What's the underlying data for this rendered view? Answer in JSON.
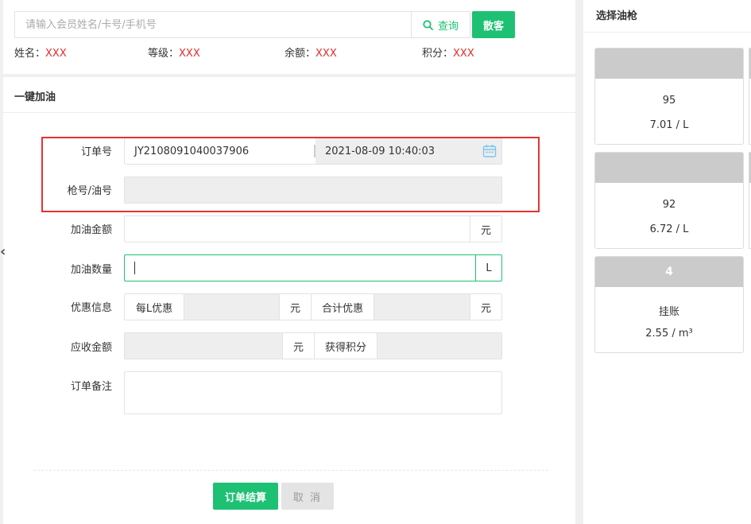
{
  "member_search": {
    "placeholder": "请输入会员姓名/卡号/手机号",
    "query_label": "查询",
    "walkin_label": "散客"
  },
  "member_info": [
    {
      "label": "姓名：",
      "value": "XXX"
    },
    {
      "label": "等级：",
      "value": "XXX"
    },
    {
      "label": "余额：",
      "value": "XXX"
    },
    {
      "label": "积分：",
      "value": "XXX"
    }
  ],
  "refuel": {
    "section_title": "一键加油",
    "order_no_label": "订单号",
    "order_no_value": "JY2108091040037906",
    "order_time_value": "2021-08-09 10:40:03",
    "gun_oil_label": "枪号/油号",
    "amount_label": "加油金额",
    "amount_unit": "元",
    "volume_label": "加油数量",
    "volume_unit": "L",
    "discount_label": "优惠信息",
    "per_l_discount_label": "每L优惠",
    "per_l_unit": "元",
    "total_discount_label": "合计优惠",
    "total_unit": "元",
    "receivable_label": "应收金额",
    "receivable_unit": "元",
    "points_label": "获得积分",
    "remark_label": "订单备注",
    "submit_label": "订单结算",
    "cancel_label": "取 消"
  },
  "nav": {
    "collapse_icon": "chevron-left-icon"
  },
  "guns_panel": {
    "title": "选择油枪",
    "guns": [
      {
        "number": "",
        "oil": "95",
        "price": "7.01 / L"
      },
      {
        "number": "",
        "oil": "92",
        "price": "6.72 / L"
      },
      {
        "number": "4",
        "oil": "挂账",
        "price": "2.55 / m³"
      }
    ]
  },
  "colors": {
    "accent": "#1ec173",
    "highlight": "#e53333",
    "value_red": "#e52b2b"
  }
}
